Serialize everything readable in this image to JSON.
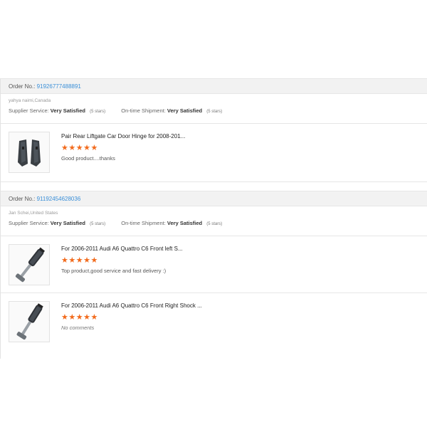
{
  "orders": [
    {
      "order_label": "Order No.:",
      "order_no": "91926777488891",
      "buyer": "yahya naimi,Canada",
      "supplier_label": "Supplier Service:",
      "supplier_value": "Very Satisfied",
      "supplier_stars": "(5 stars)",
      "shipment_label": "On-time Shipment:",
      "shipment_value": "Very Satisfied",
      "shipment_stars": "(5 stars)",
      "items": [
        {
          "title": "Pair Rear Liftgate Car Door Hinge for 2008-201...",
          "stars": "★★★★★",
          "rating": 5,
          "comment": "Good product....thanks"
        }
      ]
    },
    {
      "order_label": "Order No.:",
      "order_no": "91192454628036",
      "buyer": "Jan Schei,United States",
      "supplier_label": "Supplier Service:",
      "supplier_value": "Very Satisfied",
      "supplier_stars": "(5 stars)",
      "shipment_label": "On-time Shipment:",
      "shipment_value": "Very Satisfied",
      "shipment_stars": "(5 stars)",
      "items": [
        {
          "title": "For 2006-2011 Audi A6 Quattro C6 Front left S...",
          "stars": "★★★★★",
          "rating": 5,
          "comment": "Top product,good service and fast delivery :)"
        },
        {
          "title": "For 2006-2011 Audi A6 Quattro C6 Front Right Shock ...",
          "stars": "★★★★★",
          "rating": 5,
          "comment": "No comments"
        }
      ]
    }
  ],
  "colors": {
    "accent": "#3a8fd8",
    "star": "#f26b1d"
  }
}
